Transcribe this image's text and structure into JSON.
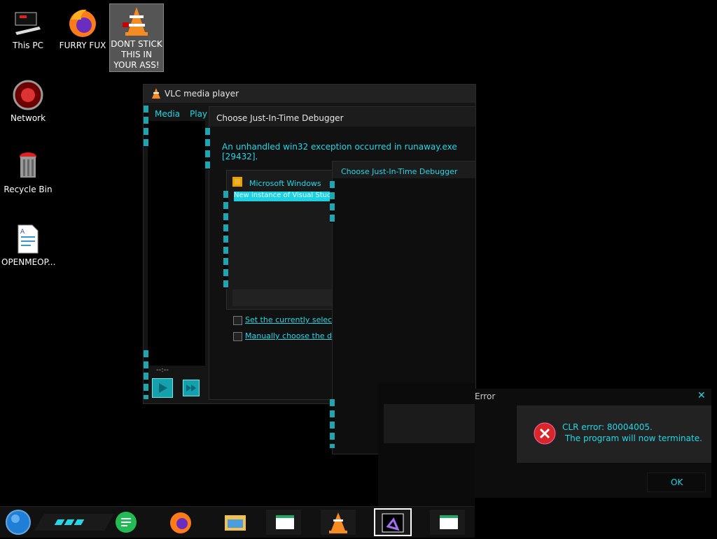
{
  "desktop": {
    "icons": [
      {
        "label": "This PC",
        "icon": "computer-icon"
      },
      {
        "label": "FURRY FUX",
        "icon": "firefox-icon"
      },
      {
        "label": "DONT STICK THIS IN YOUR ASS!",
        "icon": "vlc-cone-icon"
      },
      {
        "label": "Network",
        "icon": "network-orb-icon"
      },
      {
        "label": "Recycle Bin",
        "icon": "recycle-bin-icon"
      },
      {
        "label": "OPENMEOP...",
        "icon": "document-icon"
      }
    ]
  },
  "vlc": {
    "title": "VLC media player",
    "menu_media": "Media",
    "menu_playback": "Play",
    "time": "--:--"
  },
  "jit_main": {
    "title": "Choose Just-In-Time Debugger",
    "message": "An unhandled win32 exception occurred in runaway.exe [29432].",
    "list_header": "Microsoft Windows",
    "list_selected": "New instance of Visual Studio",
    "checkbox_default": "Set the currently selected",
    "checkbox_manual": "Manually choose the debug"
  },
  "jit_second": {
    "title": "Choose Just-In-Time Debugger"
  },
  "error_dialog": {
    "title_partial": "Error",
    "close": "✕",
    "line1": "CLR error: 80004005.",
    "line2": " The program will now terminate.",
    "ok": "OK"
  },
  "taskbar": {
    "items": [
      "start-orb-icon",
      "notes-app-icon",
      "firefox-icon",
      "file-explorer-icon",
      "document-window-icon",
      "vlc-cone-icon",
      "visual-studio-icon",
      "document-window-icon"
    ]
  },
  "colors": {
    "accent": "#23d7e7",
    "error_red": "#d8262b"
  }
}
